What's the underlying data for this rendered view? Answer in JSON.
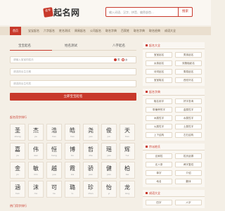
{
  "header": {
    "logo_seal": "名字",
    "logo_text": "起名网",
    "search_placeholder": "输入词语、汉字、拼音、偏旁部首...",
    "search_button": "搜索"
  },
  "nav": {
    "items": [
      "首页",
      "宝宝起名",
      "六字起名",
      "姓名测试",
      "周易起名",
      "公司起名",
      "取名字典",
      "百家姓",
      "取名字典",
      "取名经典",
      "成语大全"
    ]
  },
  "tabs": {
    "items": [
      "宝宝起名",
      "姓名测试",
      "八字起名"
    ]
  },
  "form": {
    "surname_placeholder": "请输入宝宝的姓氏",
    "gender_male": "男",
    "gender_female": "女",
    "birthday_placeholder": "请选择出生日期",
    "birthtime_placeholder": "请选择出生时辰",
    "submit_label": "立即宝宝起名"
  },
  "sections": {
    "chars_title": "起名用字排行",
    "bottom_title": "热门用字排行"
  },
  "chars": [
    {
      "ch": "圣",
      "py": "sheng"
    },
    {
      "ch": "杰",
      "py": "jie"
    },
    {
      "ch": "浩",
      "py": "hao"
    },
    {
      "ch": "皓",
      "py": "hao"
    },
    {
      "ch": "尧",
      "py": "yao"
    },
    {
      "ch": "俊",
      "py": "jun"
    },
    {
      "ch": "天",
      "py": "tian"
    },
    {
      "ch": "嘉",
      "py": "jia"
    },
    {
      "ch": "伟",
      "py": "wei"
    },
    {
      "ch": "恒",
      "py": "heng"
    },
    {
      "ch": "博",
      "py": "bo"
    },
    {
      "ch": "哲",
      "py": "zhe"
    },
    {
      "ch": "瑶",
      "py": "yao"
    },
    {
      "ch": "辉",
      "py": "hui"
    },
    {
      "ch": "金",
      "py": "jin"
    },
    {
      "ch": "敏",
      "py": "min"
    },
    {
      "ch": "越",
      "py": "yue"
    },
    {
      "ch": "霞",
      "py": "xia"
    },
    {
      "ch": "骄",
      "py": "jiao"
    },
    {
      "ch": "健",
      "py": "jian"
    },
    {
      "ch": "柏",
      "py": "bai"
    },
    {
      "ch": "涵",
      "py": "han"
    },
    {
      "ch": "沫",
      "py": "mo"
    },
    {
      "ch": "可",
      "py": "ke"
    },
    {
      "ch": "璐",
      "py": "lu"
    },
    {
      "ch": "珍",
      "py": "zhen"
    },
    {
      "ch": "怡",
      "py": "yi"
    },
    {
      "ch": "龙",
      "py": "long"
    }
  ],
  "sidebar": {
    "box1": {
      "title": "起名大全",
      "items": [
        "宝宝起名",
        "男孩起名",
        "女孩起名",
        "双胞胎起名",
        "诗词起名",
        "周易起名",
        "宝宝取名",
        "西班牙名"
      ]
    },
    "box2": {
      "title": "起名字典",
      "items": [
        "取名用字",
        "好字查询",
        "带偏旁的字",
        "金属性字",
        "木属性字",
        "水属性字",
        "火属性字",
        "土属性字",
        "上下结构",
        "左右结构"
      ]
    },
    "box3": {
      "title": "宗派姓氏",
      "items": [
        "百家姓",
        "姓氏起源",
        "名人录",
        "两字复姓",
        "单字",
        "介绍",
        "地名",
        "翻译"
      ]
    },
    "box4": {
      "title": "成语大全",
      "items": [
        "四字",
        "六字"
      ]
    }
  }
}
